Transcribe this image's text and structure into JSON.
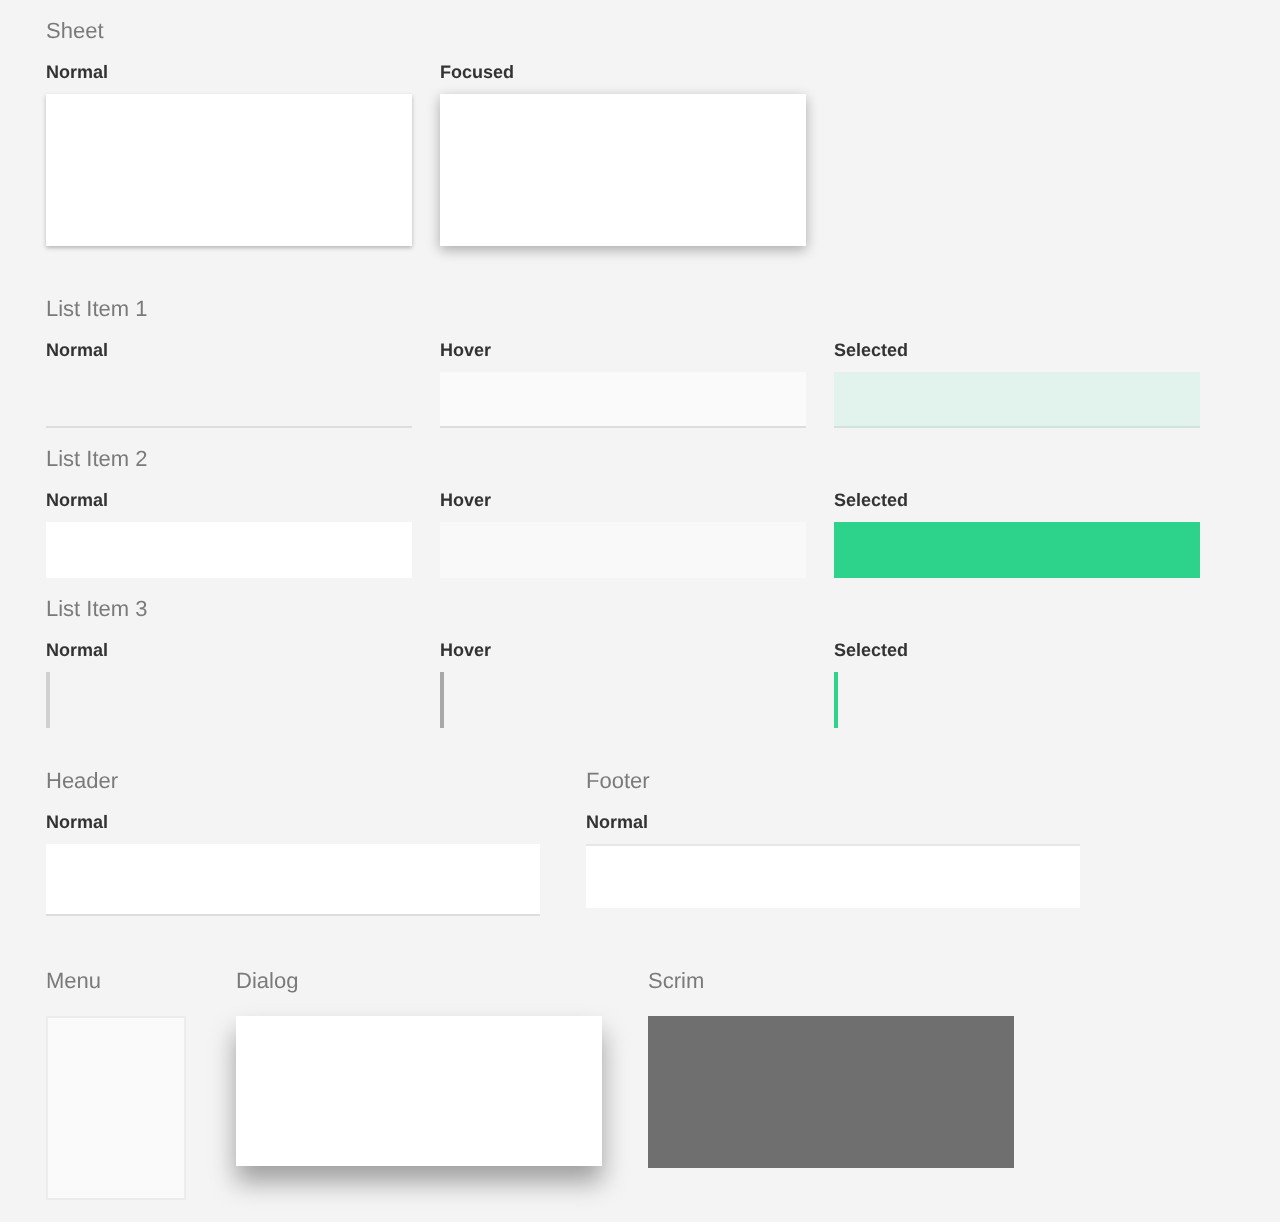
{
  "sheet": {
    "title": "Sheet",
    "variants": [
      {
        "label": "Normal",
        "kind": "flat"
      },
      {
        "label": "Focused",
        "kind": "raised"
      }
    ]
  },
  "list_items": [
    {
      "title": "List Item 1",
      "variants": [
        {
          "label": "Normal",
          "kind": "underline"
        },
        {
          "label": "Hover",
          "kind": "underline-hover"
        },
        {
          "label": "Selected",
          "kind": "underline-selected"
        }
      ]
    },
    {
      "title": "List Item 2",
      "variants": [
        {
          "label": "Normal",
          "kind": "fill"
        },
        {
          "label": "Hover",
          "kind": "fill-hover"
        },
        {
          "label": "Selected",
          "kind": "fill-selected"
        }
      ]
    },
    {
      "title": "List Item 3",
      "variants": [
        {
          "label": "Normal",
          "kind": "bar"
        },
        {
          "label": "Hover",
          "kind": "bar-hover"
        },
        {
          "label": "Selected",
          "kind": "bar-selected"
        }
      ]
    }
  ],
  "bars": [
    {
      "title": "Header",
      "state": "Normal",
      "kind": "header"
    },
    {
      "title": "Footer",
      "state": "Normal",
      "kind": "footer"
    }
  ],
  "surfaces": [
    {
      "title": "Menu",
      "kind": "menu"
    },
    {
      "title": "Dialog",
      "kind": "dialog"
    },
    {
      "title": "Scrim",
      "kind": "scrim"
    }
  ]
}
